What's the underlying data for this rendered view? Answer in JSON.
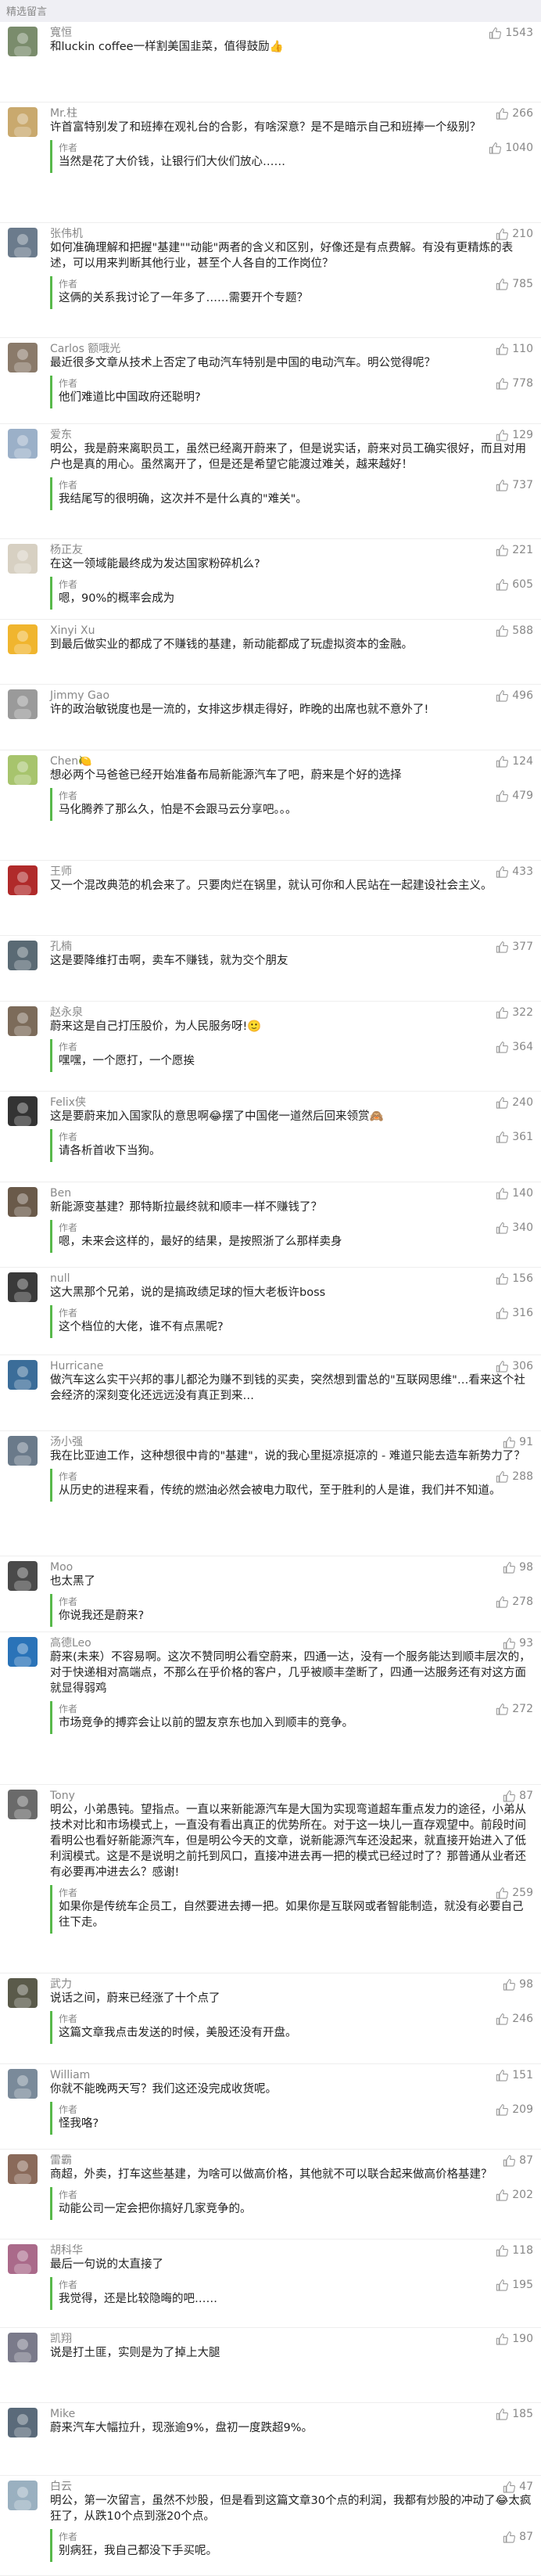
{
  "header": {
    "title": "精选留言"
  },
  "comments": [
    {
      "user": "寬恒",
      "likes": "1543",
      "text": "和luckin coffee一样割美国韭菜，值得鼓励👍",
      "reply": null,
      "avatar_color": "#7a8c6c"
    },
    {
      "user": "Mr.柱",
      "likes": "266",
      "text": "许首富特别发了和班捧在观礼台的合影，有啥深意？是不是暗示自己和班捧一个级别？",
      "reply": {
        "label": "作者",
        "likes": "1040",
        "text": "当然是花了大价钱，让银行们大伙们放心……"
      },
      "avatar_color": "#c9a96e"
    },
    {
      "user": "张伟机",
      "likes": "210",
      "text": "如何准确理解和把握\"基建\"\"动能\"两者的含义和区别，好像还是有点费解。有没有更精炼的表述，可以用来判断其他行业，甚至个人各自的工作岗位？",
      "reply": {
        "label": "作者",
        "likes": "785",
        "text": "这俩的关系我讨论了一年多了……需要开个专题？"
      },
      "avatar_color": "#6b7b8c"
    },
    {
      "user": "Carlos 额哦光",
      "likes": "110",
      "text": "最近很多文章从技术上否定了电动汽车特别是中国的电动汽车。明公觉得呢？",
      "reply": {
        "label": "作者",
        "likes": "778",
        "text": "他们难道比中国政府还聪明?"
      },
      "avatar_color": "#8a7a6a"
    },
    {
      "user": "爱东",
      "likes": "129",
      "text": "明公，我是蔚来离职员工，虽然已经离开蔚来了，但是说实话，蔚来对员工确实很好，而且对用户也是真的用心。虽然离开了，但是还是希望它能渡过难关，越来越好！",
      "reply": {
        "label": "作者",
        "likes": "737",
        "text": "我结尾写的很明确，这次并不是什么真的\"难关\"。"
      },
      "avatar_color": "#9bb0c8"
    },
    {
      "user": "杨正友",
      "likes": "221",
      "text": "在这一领域能最终成为发达国家粉碎机么?",
      "reply": {
        "label": "作者",
        "likes": "605",
        "text": "嗯，90%的概率会成为"
      },
      "avatar_color": "#d7d0c2"
    },
    {
      "user": "Xinyi Xu",
      "likes": "588",
      "text": "到最后做实业的都成了不赚钱的基建，新动能都成了玩虚拟资本的金融。",
      "reply": null,
      "avatar_color": "#f0b52e"
    },
    {
      "user": "Jimmy Gao",
      "likes": "496",
      "text": "许的政治敏锐度也是一流的，女排这步棋走得好，昨晚的出席也就不意外了!",
      "reply": null,
      "avatar_color": "#9a9a9a"
    },
    {
      "user": "Chen🍋",
      "likes": "124",
      "text": "想必两个马爸爸已经开始准备布局新能源汽车了吧，蔚来是个好的选择",
      "reply": {
        "label": "作者",
        "likes": "479",
        "text": "马化腾养了那么久，怕是不会跟马云分享吧。。。"
      },
      "avatar_color": "#a7c46d"
    },
    {
      "user": "王师",
      "likes": "433",
      "text": "又一个混改典范的机会来了。只要肉烂在锅里，就认可你和人民站在一起建设社会主义。",
      "reply": null,
      "avatar_color": "#b02a2a"
    },
    {
      "user": "孔楠",
      "likes": "377",
      "text": "这是要降维打击啊，卖车不赚钱，就为交个朋友",
      "reply": null,
      "avatar_color": "#5a6a74"
    },
    {
      "user": "赵永泉",
      "likes": "322",
      "text": "蔚来这是自己打压股价，为人民服务呀!🙂",
      "reply": {
        "label": "作者",
        "likes": "364",
        "text": "嘿嘿，一个愿打，一个愿挨"
      },
      "avatar_color": "#7c6b5a"
    },
    {
      "user": "Felix侠",
      "likes": "240",
      "text": "这是要蔚来加入国家队的意思啊😂摆了中国佬一道然后回来领赏🙈",
      "reply": {
        "label": "作者",
        "likes": "361",
        "text": "请各析首收下当狗。"
      },
      "avatar_color": "#333333"
    },
    {
      "user": "Ben",
      "likes": "140",
      "text": "新能源变基建？那特斯拉最终就和顺丰一样不赚钱了？",
      "reply": {
        "label": "作者",
        "likes": "340",
        "text": "嗯，未来会这样的，最好的结果，是按照浙了么那样卖身"
      },
      "avatar_color": "#6a5a4a"
    },
    {
      "user": "null",
      "likes": "156",
      "text": "这大黑那个兄弟，说的是搞政绩足球的恒大老板许boss",
      "reply": {
        "label": "作者",
        "likes": "316",
        "text": "这个档位的大佬，谁不有点黑呢?"
      },
      "avatar_color": "#3a3a3a"
    },
    {
      "user": "Hurricane",
      "likes": "306",
      "text": "做汽车这么实干兴邦的事儿都沦为赚不到钱的买卖，突然想到雷总的\"互联网思维\"…看来这个社会经济的深刻变化还远远没有真正到来…",
      "reply": null,
      "avatar_color": "#3b6d99"
    },
    {
      "user": "汤小强",
      "likes": "91",
      "text": "我在比亚迪工作，这种想很中肯的\"基建\"，说的我心里挺凉挺凉的 - 难道只能去造车新势力了？",
      "reply": {
        "label": "作者",
        "likes": "288",
        "text": "从历史的进程来看，传统的燃油必然会被电力取代，至于胜利的人是谁，我们并不知道。"
      },
      "avatar_color": "#6a7a8a"
    },
    {
      "user": "Moo",
      "likes": "98",
      "text": "也太黑了",
      "reply": {
        "label": "作者",
        "likes": "278",
        "text": "你说我还是蔚来?"
      },
      "avatar_color": "#4a4a4a"
    },
    {
      "user": "高德Leo",
      "likes": "93",
      "text": "蔚来(未来）不容易啊。这次不赞同明公看空蔚来，四通一达，没有一个服务能达到顺丰层次的，对于快递相对高端点，不那么在乎价格的客户，几乎被顺丰垄断了，四通一达服务还有对这方面就显得弱鸡",
      "reply": {
        "label": "作者",
        "likes": "272",
        "text": "市场竞争的搏弈会让以前的盟友京东也加入到顺丰的竞争。"
      },
      "avatar_color": "#2a73b8"
    },
    {
      "user": "Tony",
      "likes": "87",
      "text": "明公，小弟愚钝。望指点。一直以来新能源汽车是大国为实现弯道超车重点发力的途径，小弟从技术对比和市场模式上，一直没有看出真正的优势所在。对于这一块儿一直存观望中。前段时间看明公也看好新能源汽车，但是明公今天的文章，说新能源汽车还没起来，就直接开始进入了低利润模式。这是不是说明之前托到风口，直接冲进去再一把的模式已经过时了？那普通从业者还有必要再冲进去么？感谢!",
      "reply": {
        "label": "作者",
        "likes": "259",
        "text": "如果你是传统车企员工，自然要进去搏一把。如果你是互联网或者智能制造，就没有必要自己往下走。"
      },
      "avatar_color": "#6a6a6a"
    },
    {
      "user": "武力",
      "likes": "98",
      "text": "说话之间，蔚来已经涨了十个点了",
      "reply": {
        "label": "作者",
        "likes": "246",
        "text": "这篇文章我点击发送的时候，美股还没有开盘。"
      },
      "avatar_color": "#5a5a4a"
    },
    {
      "user": "William",
      "likes": "151",
      "text": "你就不能晚两天写？我们这还没完成收货呢。",
      "reply": {
        "label": "作者",
        "likes": "209",
        "text": "怪我咯?"
      },
      "avatar_color": "#7a8a9a"
    },
    {
      "user": "雷霸",
      "likes": "87",
      "text": "商超，外卖，打车这些基建，为啥可以做高价格，其他就不可以联合起来做高价格基建？",
      "reply": {
        "label": "作者",
        "likes": "202",
        "text": "动能公司一定会把你搞好几家竞争的。"
      },
      "avatar_color": "#8a6a5a"
    },
    {
      "user": "胡科华",
      "likes": "118",
      "text": "最后一句说的太直接了",
      "reply": {
        "label": "作者",
        "likes": "195",
        "text": "我觉得，还是比较隐晦的吧……"
      },
      "avatar_color": "#aa6a8a"
    },
    {
      "user": "凯翔",
      "likes": "190",
      "text": "说是打土匪，实则是为了掉上大腿",
      "reply": null,
      "avatar_color": "#7a7a8a"
    },
    {
      "user": "Mike",
      "likes": "185",
      "text": "蔚来汽车大幅拉升，现涨逾9%，盘初一度跌超9%。",
      "reply": null,
      "avatar_color": "#5a6a7a"
    },
    {
      "user": "白云",
      "likes": "47",
      "text": "明公，第一次留言，虽然不炒股，但是看到这篇文章30个点的利润，我都有炒股的冲动了😂太疯狂了，从跌10个点到涨20个点。",
      "reply": {
        "label": "作者",
        "likes": "87",
        "text": "别病狂，我自己都没下手买呢。"
      },
      "avatar_color": "#9ab0c0"
    }
  ]
}
